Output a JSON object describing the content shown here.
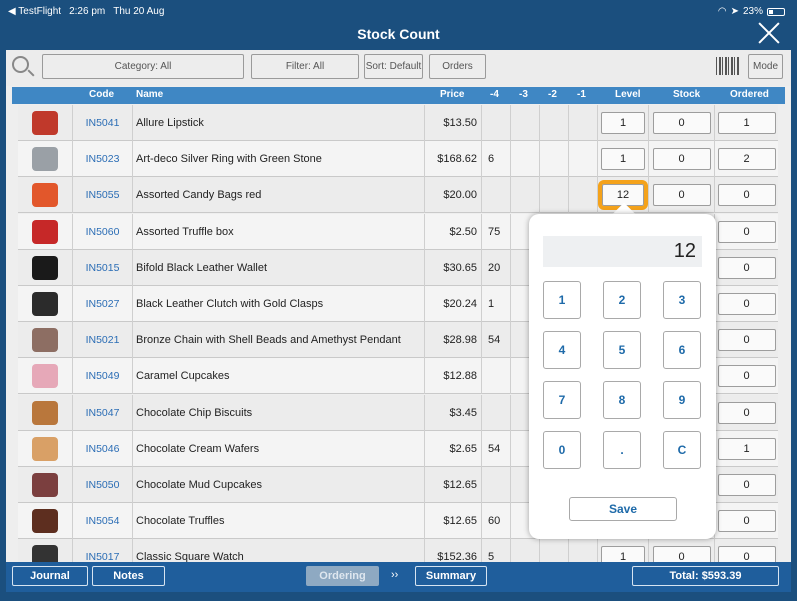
{
  "status_bar": {
    "back_label": "◀ TestFlight",
    "time": "2:26 pm",
    "date": "Thu 20 Aug",
    "battery": "23%"
  },
  "titlebar": {
    "title": "Stock Count"
  },
  "toolbar": {
    "category": "Category: All",
    "filter": "Filter: All",
    "sort": "Sort: Default",
    "orders": "Orders",
    "mode": "Mode"
  },
  "columns": {
    "code": "Code",
    "name": "Name",
    "price": "Price",
    "m4": "-4",
    "m3": "-3",
    "m2": "-2",
    "m1": "-1",
    "level": "Level",
    "stock": "Stock",
    "ordered": "Ordered"
  },
  "rows": [
    {
      "code": "IN5041",
      "name": "Allure Lipstick",
      "price": "$13.50",
      "m4": "",
      "level": "1",
      "stock": "0",
      "ordered": "1",
      "thumb_color": "#c0392b"
    },
    {
      "code": "IN5023",
      "name": "Art-deco Silver Ring with Green Stone",
      "price": "$168.62",
      "m4": "6",
      "level": "1",
      "stock": "0",
      "ordered": "2",
      "thumb_color": "#9aa0a6"
    },
    {
      "code": "IN5055",
      "name": "Assorted Candy Bags red",
      "price": "$20.00",
      "m4": "",
      "level": "12",
      "stock": "0",
      "ordered": "0",
      "thumb_color": "#e2572b"
    },
    {
      "code": "IN5060",
      "name": "Assorted Truffle box",
      "price": "$2.50",
      "m4": "75",
      "level": "",
      "stock": "",
      "ordered": "0",
      "thumb_color": "#c62828"
    },
    {
      "code": "IN5015",
      "name": "Bifold Black Leather Wallet",
      "price": "$30.65",
      "m4": "20",
      "level": "",
      "stock": "",
      "ordered": "0",
      "thumb_color": "#1a1a1a"
    },
    {
      "code": "IN5027",
      "name": "Black Leather Clutch with Gold Clasps",
      "price": "$20.24",
      "m4": "1",
      "level": "",
      "stock": "",
      "ordered": "0",
      "thumb_color": "#2b2b2b"
    },
    {
      "code": "IN5021",
      "name": "Bronze Chain with Shell Beads and Amethyst Pendant",
      "price": "$28.98",
      "m4": "54",
      "level": "",
      "stock": "",
      "ordered": "0",
      "thumb_color": "#8d6e63"
    },
    {
      "code": "IN5049",
      "name": "Caramel Cupcakes",
      "price": "$12.88",
      "m4": "",
      "level": "",
      "stock": "",
      "ordered": "0",
      "thumb_color": "#e6a8b8"
    },
    {
      "code": "IN5047",
      "name": "Chocolate Chip Biscuits",
      "price": "$3.45",
      "m4": "",
      "level": "",
      "stock": "",
      "ordered": "0",
      "thumb_color": "#b9773c"
    },
    {
      "code": "IN5046",
      "name": "Chocolate Cream Wafers",
      "price": "$2.65",
      "m4": "54",
      "level": "",
      "stock": "",
      "ordered": "1",
      "thumb_color": "#d9a066"
    },
    {
      "code": "IN5050",
      "name": "Chocolate Mud Cupcakes",
      "price": "$12.65",
      "m4": "",
      "level": "",
      "stock": "",
      "ordered": "0",
      "thumb_color": "#7b3f3f"
    },
    {
      "code": "IN5054",
      "name": "Chocolate Truffles",
      "price": "$12.65",
      "m4": "60",
      "level": "",
      "stock": "",
      "ordered": "0",
      "thumb_color": "#5d2e1f"
    },
    {
      "code": "IN5017",
      "name": "Classic Square Watch",
      "price": "$152.36",
      "m4": "5",
      "level": "1",
      "stock": "0",
      "ordered": "0",
      "thumb_color": "#333333"
    }
  ],
  "keypad": {
    "display": "12",
    "keys": [
      "1",
      "2",
      "3",
      "4",
      "5",
      "6",
      "7",
      "8",
      "9",
      "0",
      ".",
      "C"
    ],
    "save": "Save"
  },
  "bottom": {
    "journal": "Journal",
    "notes": "Notes",
    "ordering": "Ordering",
    "chevrons": "››",
    "summary": "Summary",
    "total": "Total: $593.39"
  },
  "colors": {
    "brand": "#1b4f7e",
    "header": "#3f87c4",
    "focus": "#f4a21b",
    "link": "#2b6db5"
  }
}
